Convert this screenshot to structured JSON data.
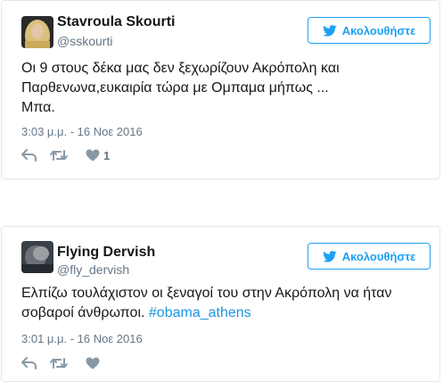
{
  "tweets": [
    {
      "name": "Stavroula Skourti",
      "handle": "@sskourti",
      "follow_label": "Ακολουθήστε",
      "text_lines": [
        "Οι 9 στους δέκα μας δεν ξεχωρίζουν Ακρόπολη και",
        "Παρθενωνα,ευκαιρία τώρα με Ομπαμα μήπως ...",
        "Μπα."
      ],
      "timestamp": "3:03 μ.μ. - 16 Νοε 2016",
      "like_count": "1",
      "avatar_icon": "profile-photo-blonde",
      "follow_icon": "twitter-bird-icon"
    },
    {
      "name": "Flying Dervish",
      "handle": "@fly_dervish",
      "follow_label": "Ακολουθήστε",
      "text_line1": "Ελπίζω τουλάχιστον οι ξεναγοί του στην Ακρόπολη να ήταν",
      "text_line2_plain": "σοβαροί άνθρωποι. ",
      "text_hashtag": "#obama_athens",
      "timestamp": "3:01 μ.μ. - 16 Νοε 2016",
      "like_count": "",
      "avatar_icon": "profile-photo-dark",
      "follow_icon": "twitter-bird-icon"
    }
  ],
  "colors": {
    "accent": "#1da1f2",
    "hashtag": "#1b95e0",
    "muted": "#657786",
    "icon": "#8899a6",
    "border": "#e1e8ed"
  }
}
